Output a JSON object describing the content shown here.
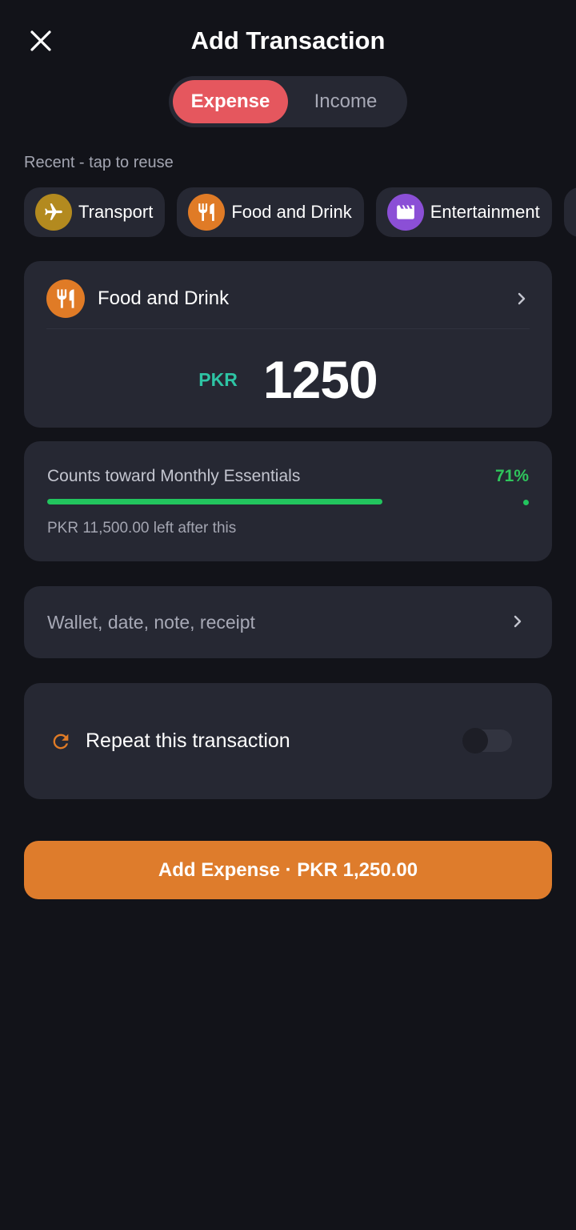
{
  "header": {
    "title": "Add Transaction"
  },
  "segment": {
    "expense_label": "Expense",
    "income_label": "Income"
  },
  "recent": {
    "label": "Recent - tap to reuse",
    "chips": [
      {
        "label": "Transport",
        "icon": "airplane-icon",
        "color": "#b38a1f"
      },
      {
        "label": "Food and Drink",
        "icon": "fork-knife-icon",
        "color": "#e07b26"
      },
      {
        "label": "Entertainment",
        "icon": "clapperboard-icon",
        "color": "#8b4fd6"
      }
    ]
  },
  "category": {
    "label": "Food and Drink",
    "icon": "fork-knife-icon",
    "color": "#e07b26"
  },
  "amount": {
    "currency": "PKR",
    "value": "1250"
  },
  "budget": {
    "title": "Counts toward Monthly Essentials",
    "percent_label": "71%",
    "percent": 71,
    "remaining_text": "PKR 11,500.00 left after this",
    "color": "#22c55e"
  },
  "details": {
    "label": "Wallet, date, note, receipt"
  },
  "repeat": {
    "label": "Repeat this transaction",
    "enabled": false,
    "icon_color": "#e07b26"
  },
  "cta": {
    "label": "Add Expense · PKR 1,250.00",
    "color": "#de7c2c"
  }
}
